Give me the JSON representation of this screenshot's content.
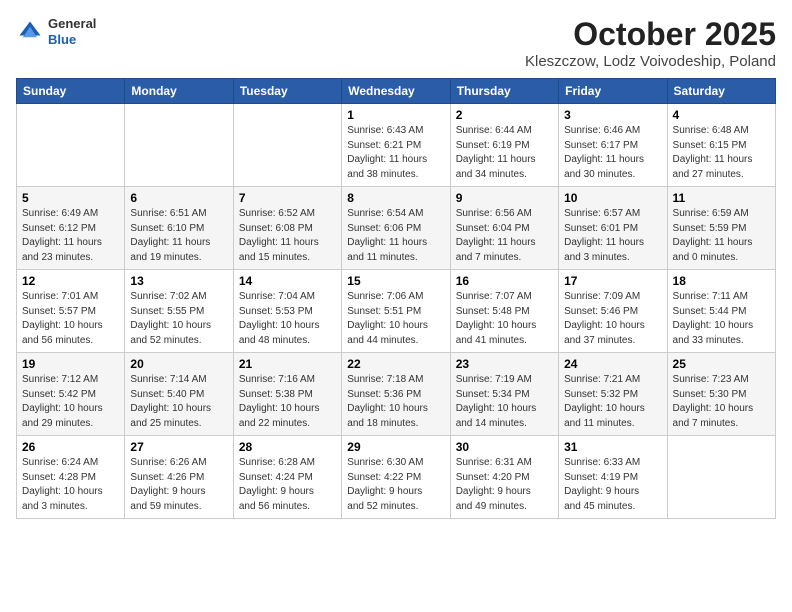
{
  "logo": {
    "general": "General",
    "blue": "Blue"
  },
  "title": "October 2025",
  "location": "Kleszczow, Lodz Voivodeship, Poland",
  "days_of_week": [
    "Sunday",
    "Monday",
    "Tuesday",
    "Wednesday",
    "Thursday",
    "Friday",
    "Saturday"
  ],
  "weeks": [
    [
      {
        "day": "",
        "info": ""
      },
      {
        "day": "",
        "info": ""
      },
      {
        "day": "",
        "info": ""
      },
      {
        "day": "1",
        "info": "Sunrise: 6:43 AM\nSunset: 6:21 PM\nDaylight: 11 hours\nand 38 minutes."
      },
      {
        "day": "2",
        "info": "Sunrise: 6:44 AM\nSunset: 6:19 PM\nDaylight: 11 hours\nand 34 minutes."
      },
      {
        "day": "3",
        "info": "Sunrise: 6:46 AM\nSunset: 6:17 PM\nDaylight: 11 hours\nand 30 minutes."
      },
      {
        "day": "4",
        "info": "Sunrise: 6:48 AM\nSunset: 6:15 PM\nDaylight: 11 hours\nand 27 minutes."
      }
    ],
    [
      {
        "day": "5",
        "info": "Sunrise: 6:49 AM\nSunset: 6:12 PM\nDaylight: 11 hours\nand 23 minutes."
      },
      {
        "day": "6",
        "info": "Sunrise: 6:51 AM\nSunset: 6:10 PM\nDaylight: 11 hours\nand 19 minutes."
      },
      {
        "day": "7",
        "info": "Sunrise: 6:52 AM\nSunset: 6:08 PM\nDaylight: 11 hours\nand 15 minutes."
      },
      {
        "day": "8",
        "info": "Sunrise: 6:54 AM\nSunset: 6:06 PM\nDaylight: 11 hours\nand 11 minutes."
      },
      {
        "day": "9",
        "info": "Sunrise: 6:56 AM\nSunset: 6:04 PM\nDaylight: 11 hours\nand 7 minutes."
      },
      {
        "day": "10",
        "info": "Sunrise: 6:57 AM\nSunset: 6:01 PM\nDaylight: 11 hours\nand 3 minutes."
      },
      {
        "day": "11",
        "info": "Sunrise: 6:59 AM\nSunset: 5:59 PM\nDaylight: 11 hours\nand 0 minutes."
      }
    ],
    [
      {
        "day": "12",
        "info": "Sunrise: 7:01 AM\nSunset: 5:57 PM\nDaylight: 10 hours\nand 56 minutes."
      },
      {
        "day": "13",
        "info": "Sunrise: 7:02 AM\nSunset: 5:55 PM\nDaylight: 10 hours\nand 52 minutes."
      },
      {
        "day": "14",
        "info": "Sunrise: 7:04 AM\nSunset: 5:53 PM\nDaylight: 10 hours\nand 48 minutes."
      },
      {
        "day": "15",
        "info": "Sunrise: 7:06 AM\nSunset: 5:51 PM\nDaylight: 10 hours\nand 44 minutes."
      },
      {
        "day": "16",
        "info": "Sunrise: 7:07 AM\nSunset: 5:48 PM\nDaylight: 10 hours\nand 41 minutes."
      },
      {
        "day": "17",
        "info": "Sunrise: 7:09 AM\nSunset: 5:46 PM\nDaylight: 10 hours\nand 37 minutes."
      },
      {
        "day": "18",
        "info": "Sunrise: 7:11 AM\nSunset: 5:44 PM\nDaylight: 10 hours\nand 33 minutes."
      }
    ],
    [
      {
        "day": "19",
        "info": "Sunrise: 7:12 AM\nSunset: 5:42 PM\nDaylight: 10 hours\nand 29 minutes."
      },
      {
        "day": "20",
        "info": "Sunrise: 7:14 AM\nSunset: 5:40 PM\nDaylight: 10 hours\nand 25 minutes."
      },
      {
        "day": "21",
        "info": "Sunrise: 7:16 AM\nSunset: 5:38 PM\nDaylight: 10 hours\nand 22 minutes."
      },
      {
        "day": "22",
        "info": "Sunrise: 7:18 AM\nSunset: 5:36 PM\nDaylight: 10 hours\nand 18 minutes."
      },
      {
        "day": "23",
        "info": "Sunrise: 7:19 AM\nSunset: 5:34 PM\nDaylight: 10 hours\nand 14 minutes."
      },
      {
        "day": "24",
        "info": "Sunrise: 7:21 AM\nSunset: 5:32 PM\nDaylight: 10 hours\nand 11 minutes."
      },
      {
        "day": "25",
        "info": "Sunrise: 7:23 AM\nSunset: 5:30 PM\nDaylight: 10 hours\nand 7 minutes."
      }
    ],
    [
      {
        "day": "26",
        "info": "Sunrise: 6:24 AM\nSunset: 4:28 PM\nDaylight: 10 hours\nand 3 minutes."
      },
      {
        "day": "27",
        "info": "Sunrise: 6:26 AM\nSunset: 4:26 PM\nDaylight: 9 hours\nand 59 minutes."
      },
      {
        "day": "28",
        "info": "Sunrise: 6:28 AM\nSunset: 4:24 PM\nDaylight: 9 hours\nand 56 minutes."
      },
      {
        "day": "29",
        "info": "Sunrise: 6:30 AM\nSunset: 4:22 PM\nDaylight: 9 hours\nand 52 minutes."
      },
      {
        "day": "30",
        "info": "Sunrise: 6:31 AM\nSunset: 4:20 PM\nDaylight: 9 hours\nand 49 minutes."
      },
      {
        "day": "31",
        "info": "Sunrise: 6:33 AM\nSunset: 4:19 PM\nDaylight: 9 hours\nand 45 minutes."
      },
      {
        "day": "",
        "info": ""
      }
    ]
  ]
}
